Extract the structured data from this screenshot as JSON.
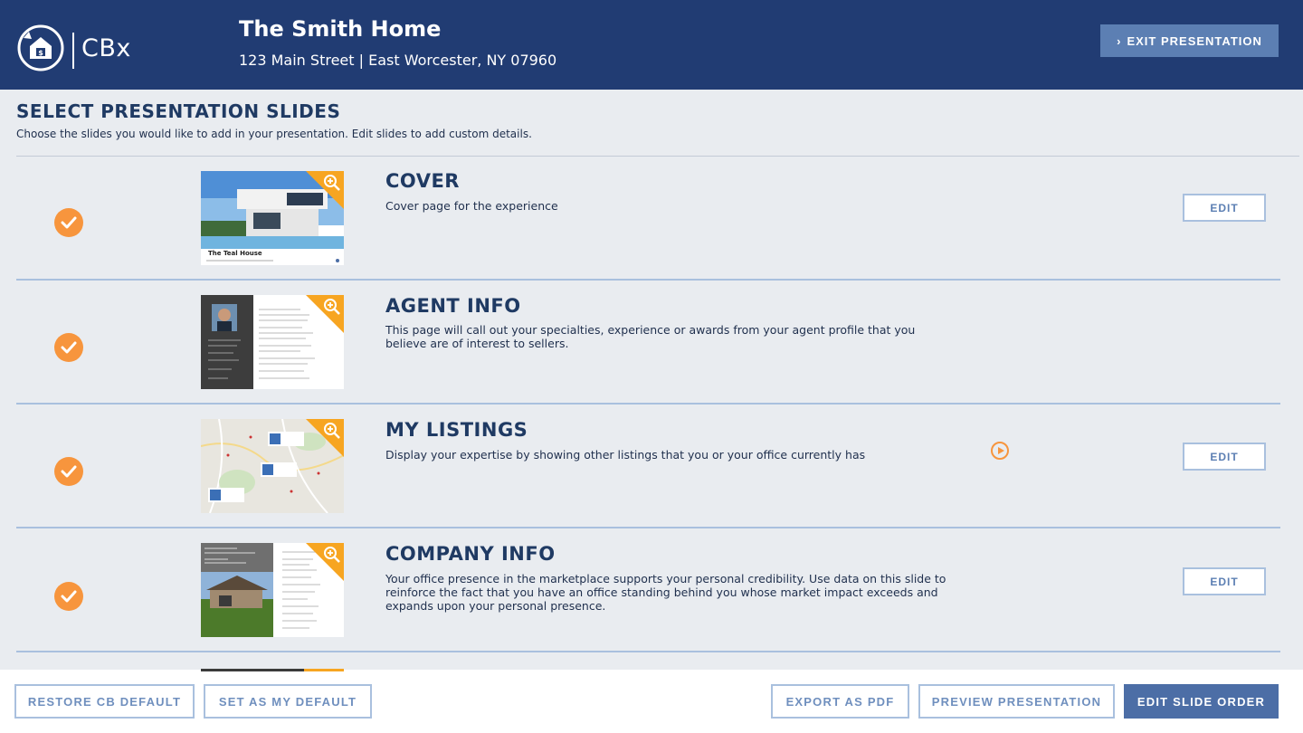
{
  "header": {
    "logo_text": "CBx",
    "home_title": "The Smith Home",
    "address": "123 Main Street | East Worcester, NY 07960",
    "exit_label": "EXIT PRESENTATION"
  },
  "section": {
    "title": "SELECT PRESENTATION SLIDES",
    "subtitle": "Choose the slides you would like to add in your presentation. Edit slides to add custom details."
  },
  "slides": [
    {
      "title": "COVER",
      "description": "Cover page for the experience",
      "selected": true,
      "edit_label": "EDIT",
      "thumb_caption": "The Teal House"
    },
    {
      "title": "AGENT INFO",
      "description": "This page will call out your specialties, experience or awards from your agent profile that you believe are of interest to sellers.",
      "selected": true,
      "edit_label": ""
    },
    {
      "title": "MY LISTINGS",
      "description": "Display your expertise by showing other listings that you or your office currently has",
      "selected": true,
      "edit_label": "EDIT"
    },
    {
      "title": "COMPANY INFO",
      "description": "Your office presence in the marketplace supports your personal credibility. Use data on this slide to reinforce the fact that you have an office standing behind you whose market impact exceeds and expands upon your personal presence.",
      "selected": true,
      "edit_label": "EDIT"
    }
  ],
  "footer": {
    "restore_label": "RESTORE CB DEFAULT",
    "set_default_label": "SET AS MY DEFAULT",
    "export_label": "EXPORT AS PDF",
    "preview_label": "PREVIEW PRESENTATION",
    "edit_order_label": "EDIT SLIDE ORDER"
  },
  "colors": {
    "header_bg": "#213c73",
    "accent_orange": "#f7953d",
    "button_blue": "#4c6ea6"
  }
}
